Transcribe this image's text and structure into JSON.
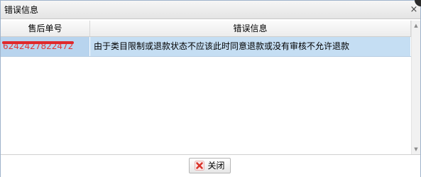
{
  "dialog": {
    "title": "错误信息",
    "close_symbol": "×"
  },
  "grid": {
    "columns": [
      "售后单号",
      "错误信息"
    ],
    "rows": [
      {
        "order_no": "6242427822472",
        "order_no_redacted": true,
        "error": "由于类目限制或退款状态不应该此时同意退款或没有审核不允许退款"
      }
    ],
    "selected_row_color": "#c5def3"
  },
  "footer": {
    "close_button_label": "关闭"
  },
  "icons": {
    "title_close": "close-icon",
    "button": "red-x-icon",
    "scroll_up": "arrow-up-icon",
    "scroll_down": "arrow-down-icon"
  },
  "colors": {
    "redaction": "#e0282b",
    "button_icon": "#d9342b"
  }
}
